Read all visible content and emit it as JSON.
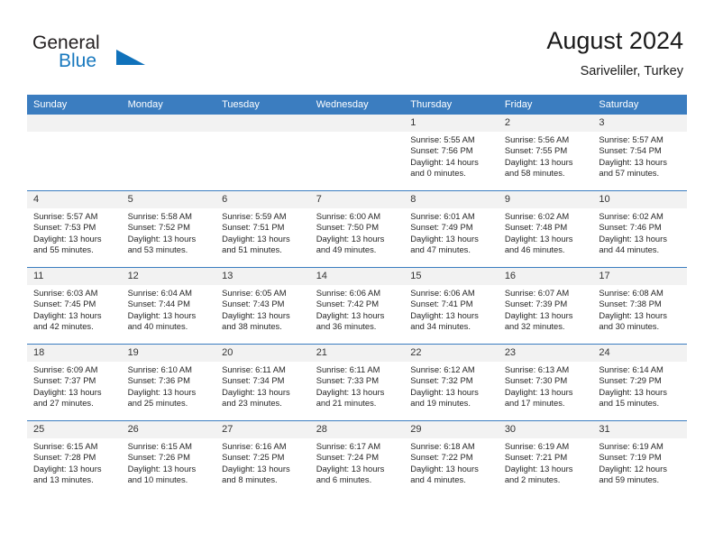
{
  "brand": {
    "name_part1": "General",
    "name_part2": "Blue",
    "accent_color": "#1072bb"
  },
  "header": {
    "title": "August 2024",
    "subtitle": "Sariveliler, Turkey"
  },
  "theme": {
    "header_row_color": "#3b7dc0",
    "daynum_band_color": "#f2f2f2",
    "text_color": "#262626"
  },
  "weekday_headers": [
    "Sunday",
    "Monday",
    "Tuesday",
    "Wednesday",
    "Thursday",
    "Friday",
    "Saturday"
  ],
  "weeks": [
    [
      {
        "day": "",
        "empty": true
      },
      {
        "day": "",
        "empty": true
      },
      {
        "day": "",
        "empty": true
      },
      {
        "day": "",
        "empty": true
      },
      {
        "day": "1",
        "sunrise": "Sunrise: 5:55 AM",
        "sunset": "Sunset: 7:56 PM",
        "daylight_1": "Daylight: 14 hours",
        "daylight_2": "and 0 minutes."
      },
      {
        "day": "2",
        "sunrise": "Sunrise: 5:56 AM",
        "sunset": "Sunset: 7:55 PM",
        "daylight_1": "Daylight: 13 hours",
        "daylight_2": "and 58 minutes."
      },
      {
        "day": "3",
        "sunrise": "Sunrise: 5:57 AM",
        "sunset": "Sunset: 7:54 PM",
        "daylight_1": "Daylight: 13 hours",
        "daylight_2": "and 57 minutes."
      }
    ],
    [
      {
        "day": "4",
        "sunrise": "Sunrise: 5:57 AM",
        "sunset": "Sunset: 7:53 PM",
        "daylight_1": "Daylight: 13 hours",
        "daylight_2": "and 55 minutes."
      },
      {
        "day": "5",
        "sunrise": "Sunrise: 5:58 AM",
        "sunset": "Sunset: 7:52 PM",
        "daylight_1": "Daylight: 13 hours",
        "daylight_2": "and 53 minutes."
      },
      {
        "day": "6",
        "sunrise": "Sunrise: 5:59 AM",
        "sunset": "Sunset: 7:51 PM",
        "daylight_1": "Daylight: 13 hours",
        "daylight_2": "and 51 minutes."
      },
      {
        "day": "7",
        "sunrise": "Sunrise: 6:00 AM",
        "sunset": "Sunset: 7:50 PM",
        "daylight_1": "Daylight: 13 hours",
        "daylight_2": "and 49 minutes."
      },
      {
        "day": "8",
        "sunrise": "Sunrise: 6:01 AM",
        "sunset": "Sunset: 7:49 PM",
        "daylight_1": "Daylight: 13 hours",
        "daylight_2": "and 47 minutes."
      },
      {
        "day": "9",
        "sunrise": "Sunrise: 6:02 AM",
        "sunset": "Sunset: 7:48 PM",
        "daylight_1": "Daylight: 13 hours",
        "daylight_2": "and 46 minutes."
      },
      {
        "day": "10",
        "sunrise": "Sunrise: 6:02 AM",
        "sunset": "Sunset: 7:46 PM",
        "daylight_1": "Daylight: 13 hours",
        "daylight_2": "and 44 minutes."
      }
    ],
    [
      {
        "day": "11",
        "sunrise": "Sunrise: 6:03 AM",
        "sunset": "Sunset: 7:45 PM",
        "daylight_1": "Daylight: 13 hours",
        "daylight_2": "and 42 minutes."
      },
      {
        "day": "12",
        "sunrise": "Sunrise: 6:04 AM",
        "sunset": "Sunset: 7:44 PM",
        "daylight_1": "Daylight: 13 hours",
        "daylight_2": "and 40 minutes."
      },
      {
        "day": "13",
        "sunrise": "Sunrise: 6:05 AM",
        "sunset": "Sunset: 7:43 PM",
        "daylight_1": "Daylight: 13 hours",
        "daylight_2": "and 38 minutes."
      },
      {
        "day": "14",
        "sunrise": "Sunrise: 6:06 AM",
        "sunset": "Sunset: 7:42 PM",
        "daylight_1": "Daylight: 13 hours",
        "daylight_2": "and 36 minutes."
      },
      {
        "day": "15",
        "sunrise": "Sunrise: 6:06 AM",
        "sunset": "Sunset: 7:41 PM",
        "daylight_1": "Daylight: 13 hours",
        "daylight_2": "and 34 minutes."
      },
      {
        "day": "16",
        "sunrise": "Sunrise: 6:07 AM",
        "sunset": "Sunset: 7:39 PM",
        "daylight_1": "Daylight: 13 hours",
        "daylight_2": "and 32 minutes."
      },
      {
        "day": "17",
        "sunrise": "Sunrise: 6:08 AM",
        "sunset": "Sunset: 7:38 PM",
        "daylight_1": "Daylight: 13 hours",
        "daylight_2": "and 30 minutes."
      }
    ],
    [
      {
        "day": "18",
        "sunrise": "Sunrise: 6:09 AM",
        "sunset": "Sunset: 7:37 PM",
        "daylight_1": "Daylight: 13 hours",
        "daylight_2": "and 27 minutes."
      },
      {
        "day": "19",
        "sunrise": "Sunrise: 6:10 AM",
        "sunset": "Sunset: 7:36 PM",
        "daylight_1": "Daylight: 13 hours",
        "daylight_2": "and 25 minutes."
      },
      {
        "day": "20",
        "sunrise": "Sunrise: 6:11 AM",
        "sunset": "Sunset: 7:34 PM",
        "daylight_1": "Daylight: 13 hours",
        "daylight_2": "and 23 minutes."
      },
      {
        "day": "21",
        "sunrise": "Sunrise: 6:11 AM",
        "sunset": "Sunset: 7:33 PM",
        "daylight_1": "Daylight: 13 hours",
        "daylight_2": "and 21 minutes."
      },
      {
        "day": "22",
        "sunrise": "Sunrise: 6:12 AM",
        "sunset": "Sunset: 7:32 PM",
        "daylight_1": "Daylight: 13 hours",
        "daylight_2": "and 19 minutes."
      },
      {
        "day": "23",
        "sunrise": "Sunrise: 6:13 AM",
        "sunset": "Sunset: 7:30 PM",
        "daylight_1": "Daylight: 13 hours",
        "daylight_2": "and 17 minutes."
      },
      {
        "day": "24",
        "sunrise": "Sunrise: 6:14 AM",
        "sunset": "Sunset: 7:29 PM",
        "daylight_1": "Daylight: 13 hours",
        "daylight_2": "and 15 minutes."
      }
    ],
    [
      {
        "day": "25",
        "sunrise": "Sunrise: 6:15 AM",
        "sunset": "Sunset: 7:28 PM",
        "daylight_1": "Daylight: 13 hours",
        "daylight_2": "and 13 minutes."
      },
      {
        "day": "26",
        "sunrise": "Sunrise: 6:15 AM",
        "sunset": "Sunset: 7:26 PM",
        "daylight_1": "Daylight: 13 hours",
        "daylight_2": "and 10 minutes."
      },
      {
        "day": "27",
        "sunrise": "Sunrise: 6:16 AM",
        "sunset": "Sunset: 7:25 PM",
        "daylight_1": "Daylight: 13 hours",
        "daylight_2": "and 8 minutes."
      },
      {
        "day": "28",
        "sunrise": "Sunrise: 6:17 AM",
        "sunset": "Sunset: 7:24 PM",
        "daylight_1": "Daylight: 13 hours",
        "daylight_2": "and 6 minutes."
      },
      {
        "day": "29",
        "sunrise": "Sunrise: 6:18 AM",
        "sunset": "Sunset: 7:22 PM",
        "daylight_1": "Daylight: 13 hours",
        "daylight_2": "and 4 minutes."
      },
      {
        "day": "30",
        "sunrise": "Sunrise: 6:19 AM",
        "sunset": "Sunset: 7:21 PM",
        "daylight_1": "Daylight: 13 hours",
        "daylight_2": "and 2 minutes."
      },
      {
        "day": "31",
        "sunrise": "Sunrise: 6:19 AM",
        "sunset": "Sunset: 7:19 PM",
        "daylight_1": "Daylight: 12 hours",
        "daylight_2": "and 59 minutes."
      }
    ]
  ]
}
